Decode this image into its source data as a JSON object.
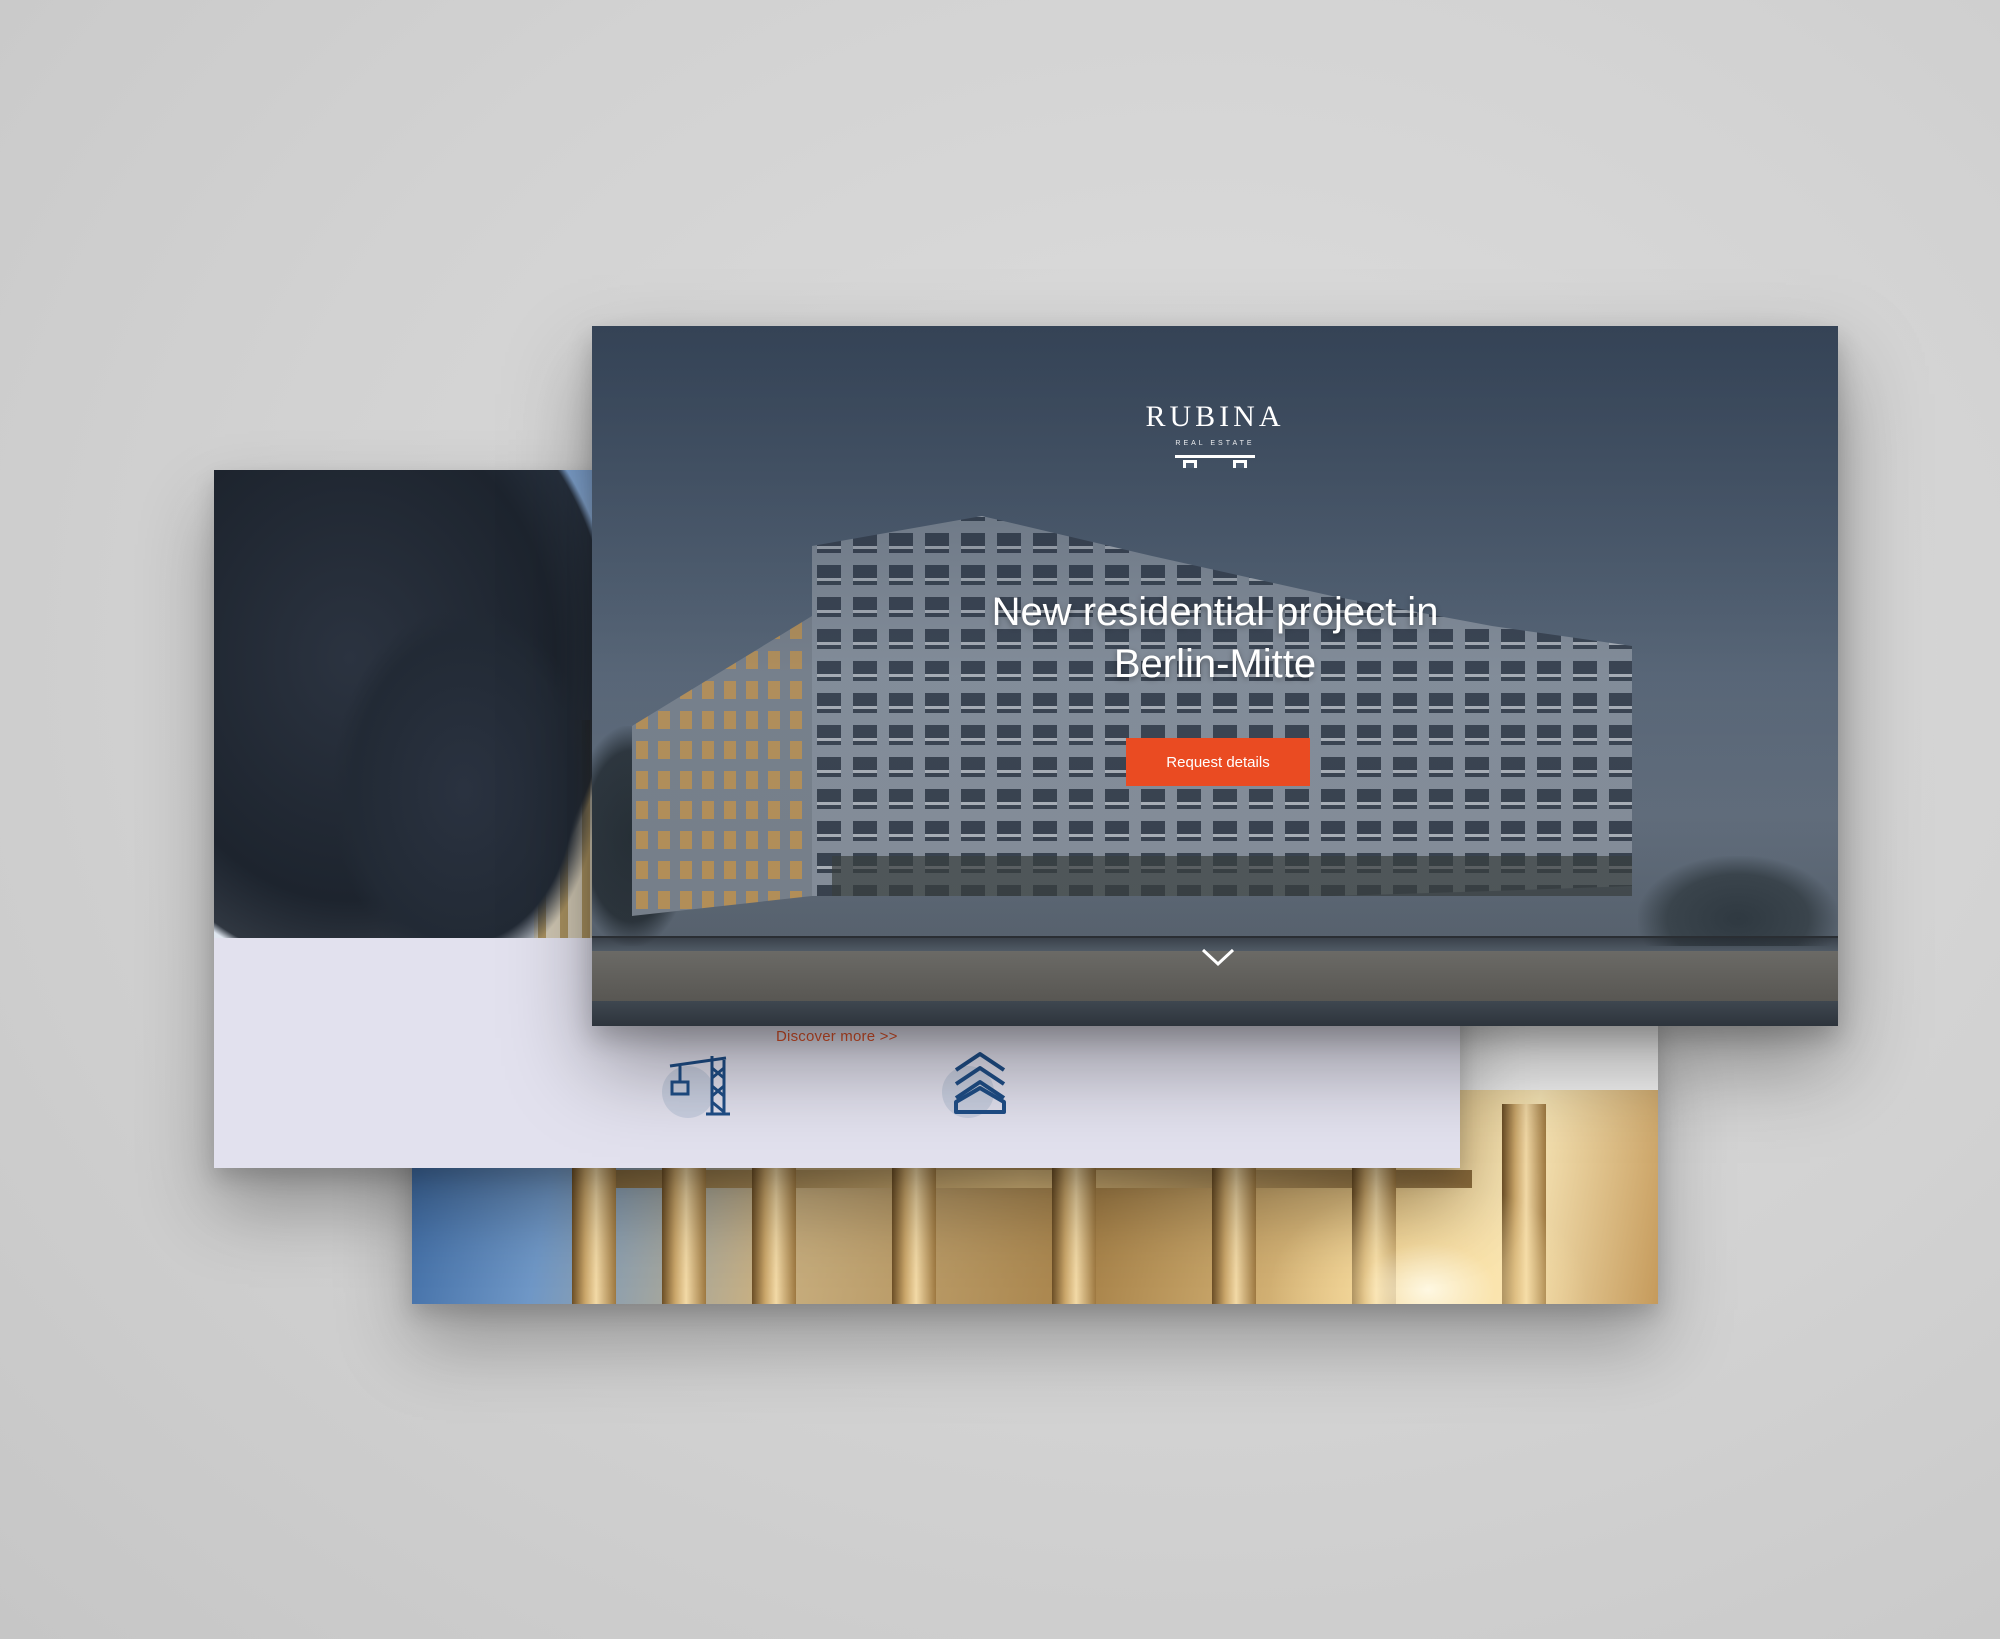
{
  "front_page": {
    "logo": {
      "name": "RUBINA",
      "tagline": "REAL ESTATE"
    },
    "hero": {
      "title_line1": "New residential project in",
      "title_line2": "Berlin-Mitte",
      "cta_label": "Request details"
    },
    "icons": {
      "scroll": "chevron-down-icon"
    }
  },
  "middle_page": {
    "discover_link": "Discover more >>",
    "feature_icons": [
      "crane-icon",
      "stacked-chevrons-icon"
    ]
  },
  "colors": {
    "accent": "#ea4b22",
    "icon_blue": "#1f4e87",
    "background": "#d6d6d6"
  }
}
